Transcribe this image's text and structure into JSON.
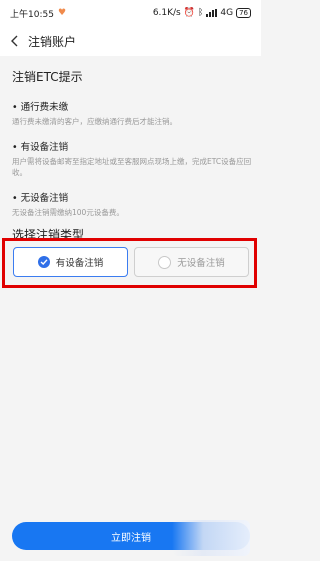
{
  "status_bar": {
    "time": "上午10:55",
    "net_speed": "6.1K/s",
    "network": "4G",
    "battery": "76"
  },
  "header": {
    "title": "注销账户"
  },
  "notice": {
    "title": "注销ETC提示",
    "items": [
      {
        "title": "• 通行费未缴",
        "desc": "通行费未缴清的客户，应缴纳通行费后才能注销。"
      },
      {
        "title": "• 有设备注销",
        "desc": "用户需将设备邮寄至指定地址或至客服网点现场上缴，完成ETC设备应回收。"
      },
      {
        "title": "• 无设备注销",
        "desc": "无设备注销需缴纳100元设备费。"
      }
    ]
  },
  "cancel_type": {
    "title": "选择注销类型",
    "options": [
      {
        "label": "有设备注销",
        "selected": true
      },
      {
        "label": "无设备注销",
        "selected": false
      }
    ]
  },
  "submit": {
    "label": "立即注销"
  },
  "colors": {
    "accent": "#1877f2",
    "highlight": "#e00000"
  }
}
